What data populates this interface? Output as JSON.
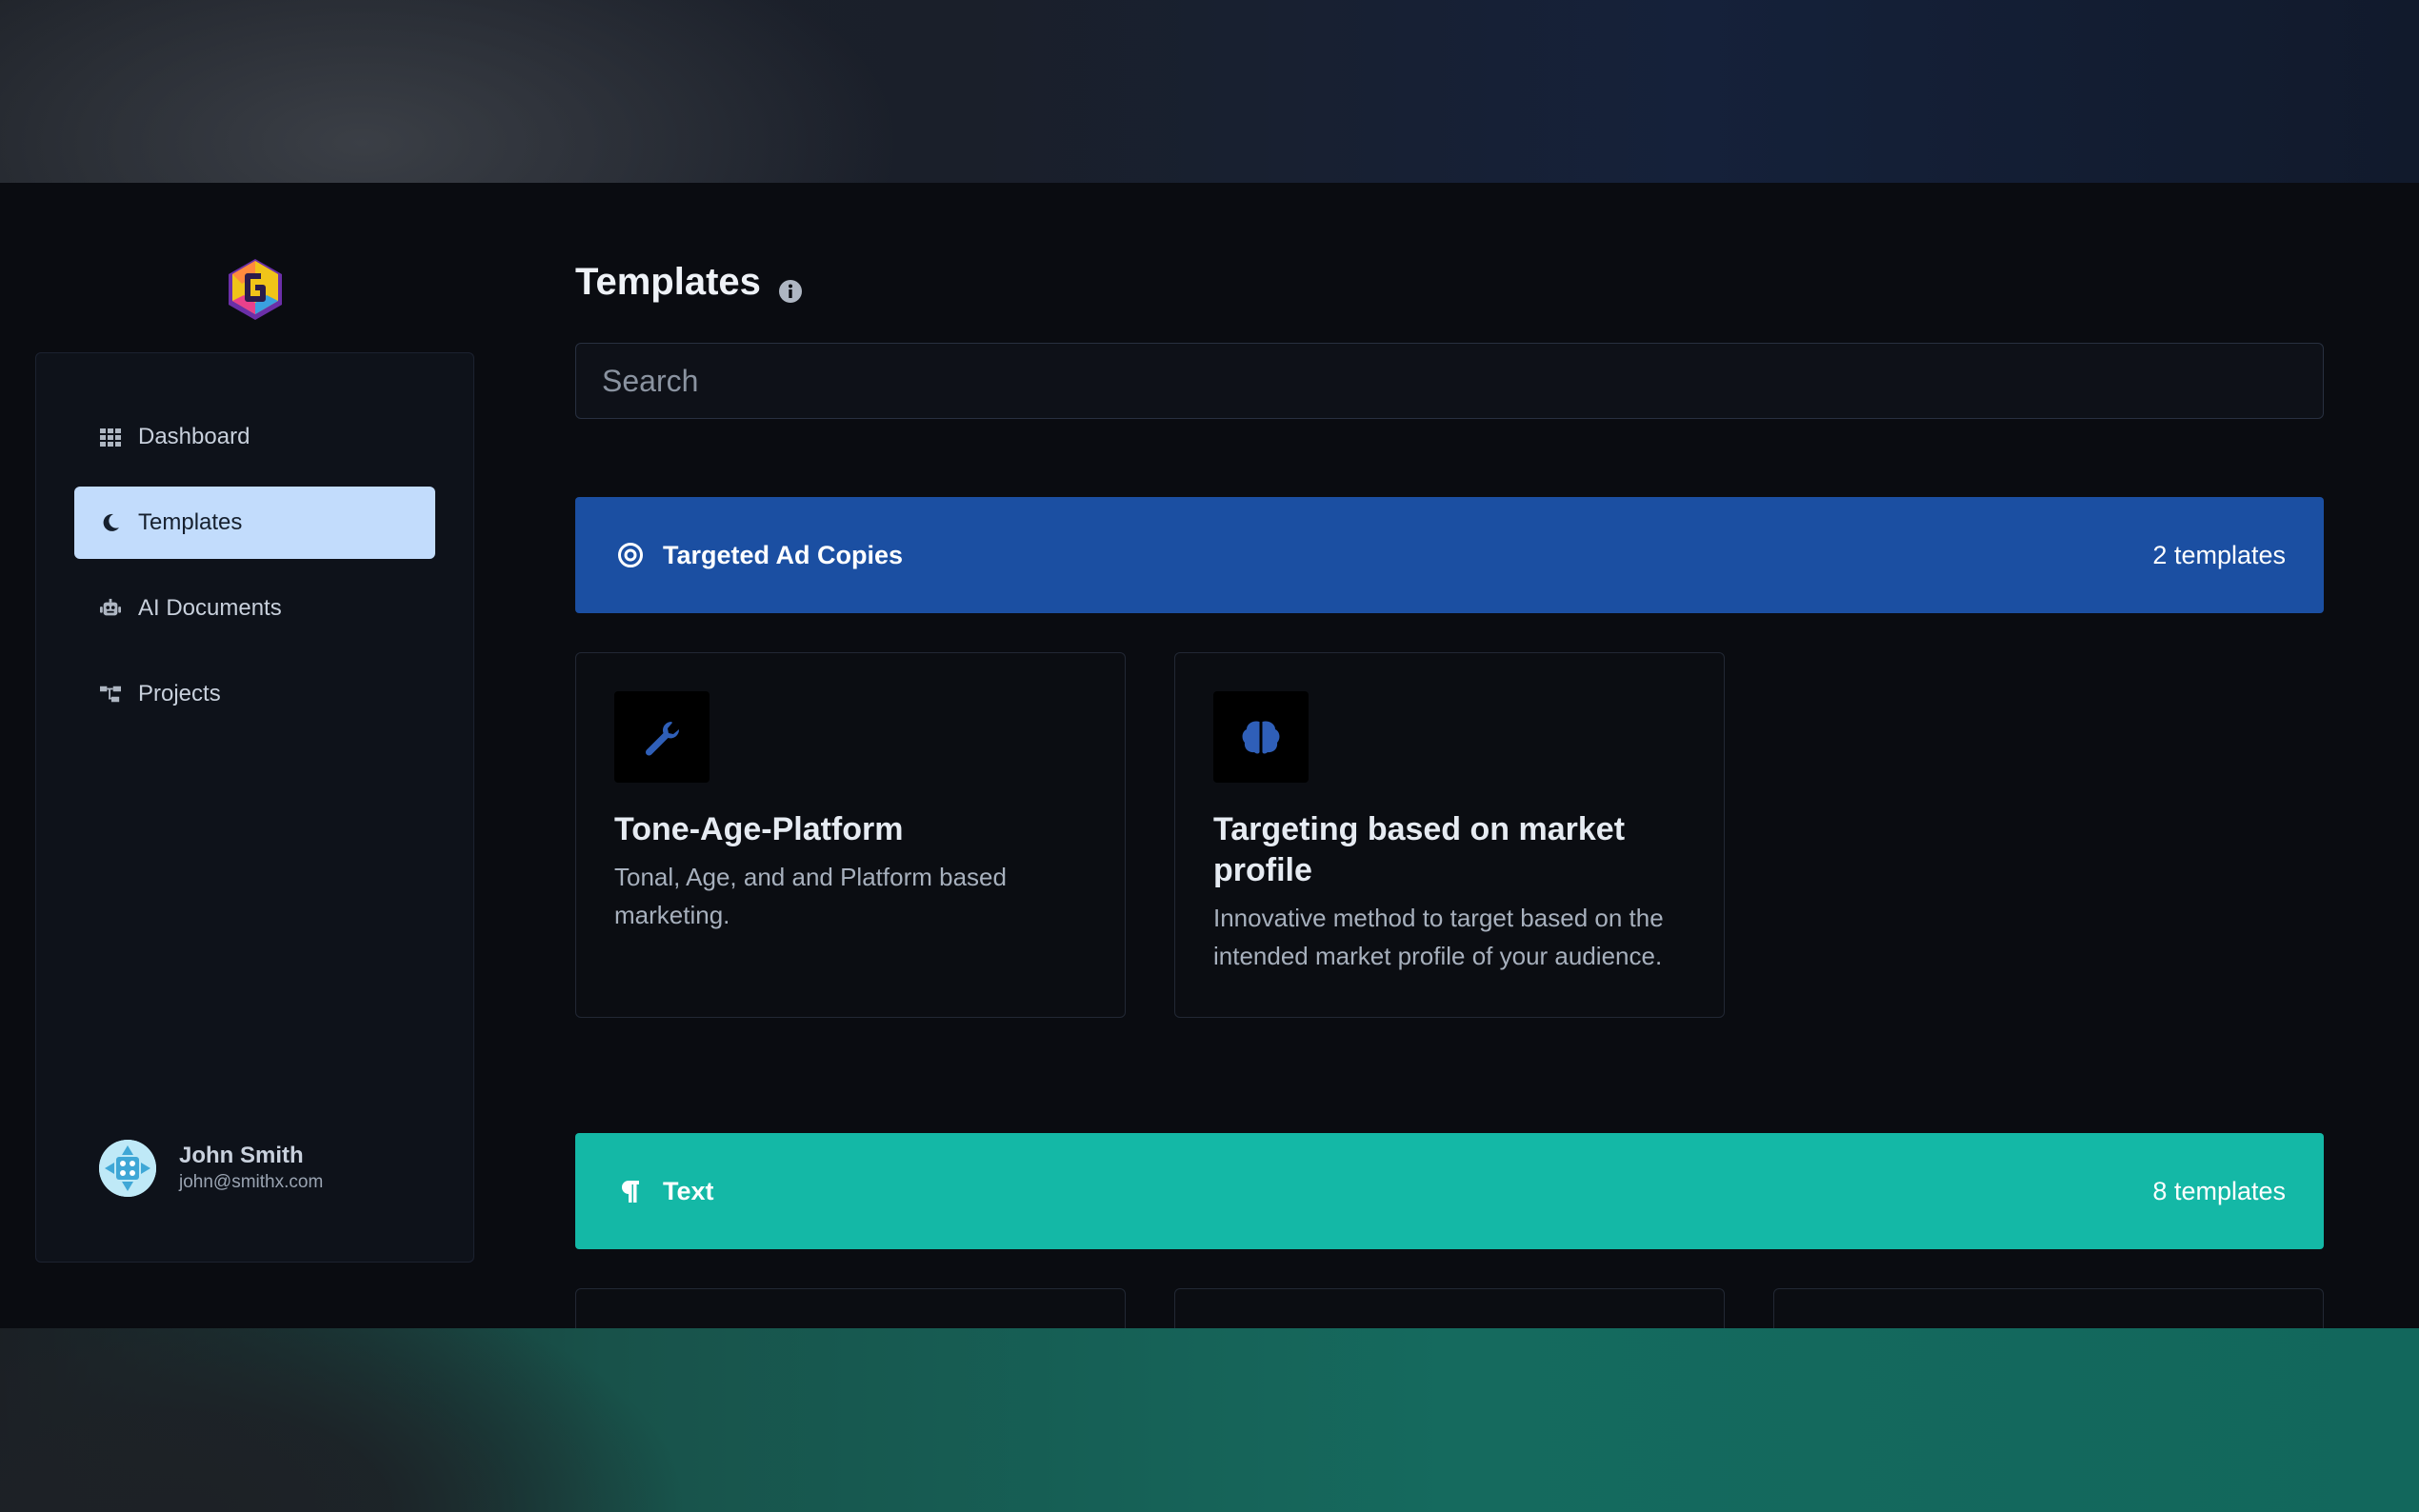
{
  "sidebar": {
    "nav": [
      {
        "label": "Dashboard",
        "icon": "grid-icon"
      },
      {
        "label": "Templates",
        "icon": "moon-icon",
        "active": true
      },
      {
        "label": "AI Documents",
        "icon": "robot-icon"
      },
      {
        "label": "Projects",
        "icon": "sitemap-icon"
      }
    ],
    "user": {
      "name": "John Smith",
      "email": "john@smithx.com"
    }
  },
  "main": {
    "title": "Templates",
    "search_placeholder": "Search",
    "categories": [
      {
        "name": "Targeted Ad Copies",
        "count": "2 templates",
        "icon": "target-icon",
        "color": "#1b4fa2",
        "templates": [
          {
            "title": "Tone-Age-Platform",
            "description": "Tonal, Age, and and Platform based marketing.",
            "icon": "wrench-icon"
          },
          {
            "title": "Targeting based on market profile",
            "description": "Innovative method to target based on the intended market profile of your audience.",
            "icon": "brain-icon"
          }
        ]
      },
      {
        "name": "Text",
        "count": "8 templates",
        "icon": "paragraph-icon",
        "color": "#14b8a6"
      }
    ]
  },
  "colors": {
    "accent_blue": "#1b4fa2",
    "accent_teal": "#14b8a6",
    "active_nav": "#c2dcfc",
    "card_icon_blue": "#2f5fb8"
  }
}
